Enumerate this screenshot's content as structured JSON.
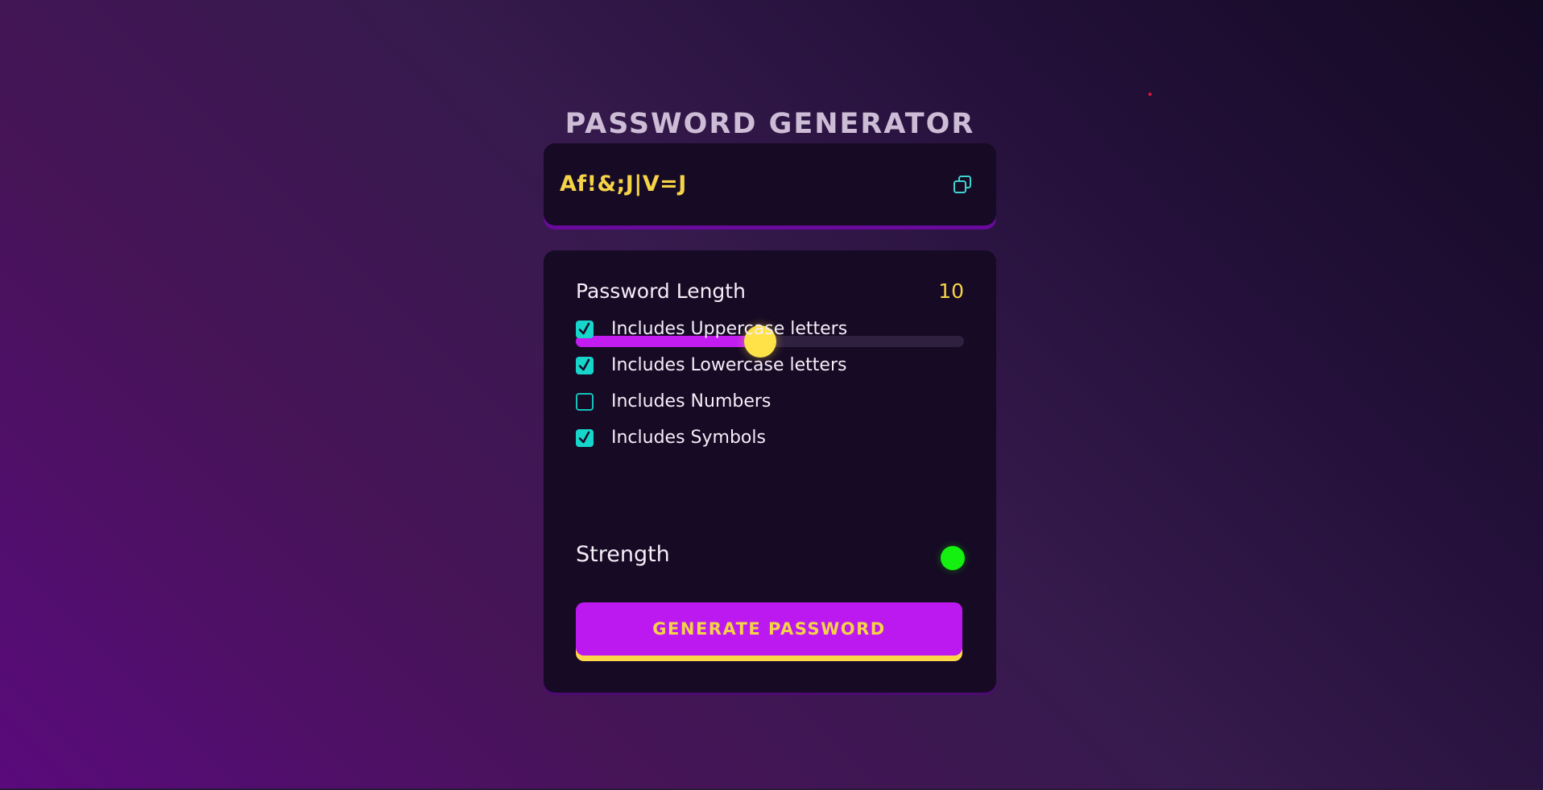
{
  "app": {
    "title": "PASSWORD GENERATOR"
  },
  "display": {
    "password": "Af!&;J|V=J",
    "copy_icon": "copy-icon"
  },
  "length": {
    "label": "Password Length",
    "value": "10",
    "slider_fraction": 0.475
  },
  "options": [
    {
      "label": "Includes Uppercase letters",
      "checked": true
    },
    {
      "label": "Includes Lowercase letters",
      "checked": true
    },
    {
      "label": "Includes Numbers",
      "checked": false
    },
    {
      "label": "Includes Symbols",
      "checked": true
    }
  ],
  "strength": {
    "label": "Strength",
    "indicator_color": "#14f00f"
  },
  "actions": {
    "generate_label": "GENERATE PASSWORD"
  },
  "colors": {
    "accent_purple": "#bb19ef",
    "accent_yellow": "#f5d347",
    "accent_teal": "#16d6cc",
    "card_bg": "#160a24"
  }
}
